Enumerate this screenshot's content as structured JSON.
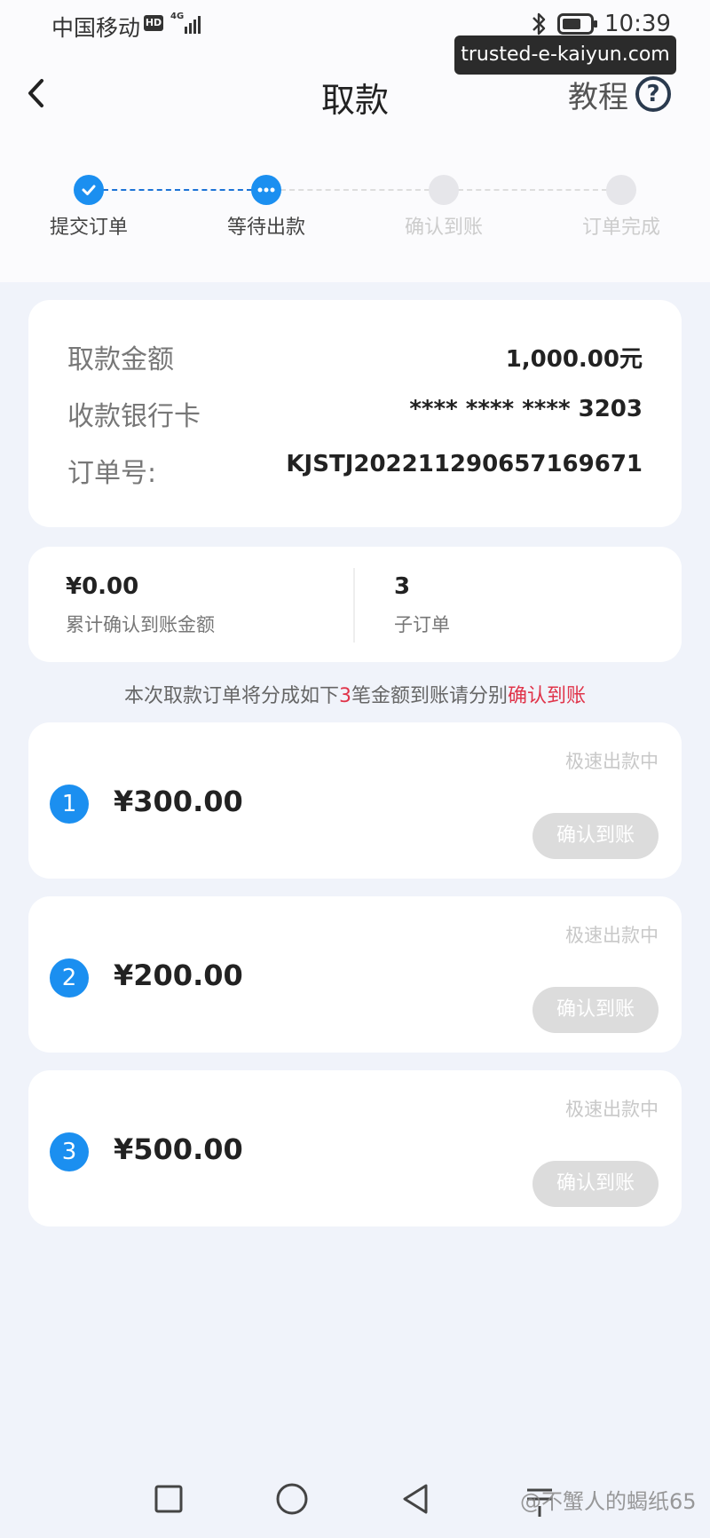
{
  "status_bar": {
    "carrier": "中国移动",
    "hd": "HD",
    "network": "4G",
    "time": "10:39"
  },
  "watermark_top": "trusted-e-kaiyun.com",
  "header": {
    "title": "取款",
    "tutorial_label": "教程",
    "help_glyph": "?"
  },
  "steps": [
    {
      "label": "提交订单",
      "state": "done"
    },
    {
      "label": "等待出款",
      "state": "current"
    },
    {
      "label": "确认到账",
      "state": "pending"
    },
    {
      "label": "订单完成",
      "state": "pending"
    }
  ],
  "info": {
    "amount_label": "取款金额",
    "amount_value": "1,000.00元",
    "card_label": "收款银行卡",
    "card_value": "**** **** **** 3203",
    "order_label": "订单号:",
    "order_value": "KJSTJ202211290657169671"
  },
  "summary": {
    "confirmed_value": "¥0.00",
    "confirmed_label": "累计确认到账金额",
    "suborders_value": "3",
    "suborders_label": "子订单"
  },
  "notice": {
    "prefix": "本次取款订单将分成如下",
    "count": "3",
    "middle": "笔金额到账请分别",
    "action": "确认到账"
  },
  "orders": [
    {
      "index": "1",
      "amount": "¥300.00",
      "status": "极速出款中",
      "button": "确认到账"
    },
    {
      "index": "2",
      "amount": "¥200.00",
      "status": "极速出款中",
      "button": "确认到账"
    },
    {
      "index": "3",
      "amount": "¥500.00",
      "status": "极速出款中",
      "button": "确认到账"
    }
  ],
  "watermark_bottom": "@不蟹人的蝎纸65",
  "colors": {
    "accent": "#1b8ff0",
    "highlight": "#e0344a",
    "disabled_button": "#dcdcdc"
  }
}
